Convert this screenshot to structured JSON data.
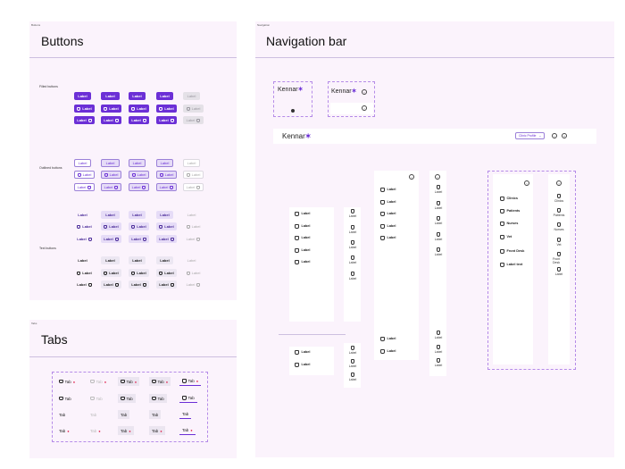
{
  "buttons_frame": {
    "small_label": "Buttons",
    "title": "Buttons",
    "rows": {
      "filled": "Filled buttons",
      "outlined": "Outlined buttons",
      "text": "Text buttons"
    },
    "btn_label": "Label"
  },
  "tabs_frame": {
    "small_label": "Tabs",
    "title": "Tabs",
    "tab_label": "Tab"
  },
  "nav_frame": {
    "small_label": "Navigation",
    "title": "Navigation bar",
    "logo_text": "Kennar",
    "logo_mark": "✶",
    "select_label": "Clinic Profile",
    "item_label": "Label",
    "drawer_items": [
      "Clinics",
      "Patients",
      "Nurses",
      "Vet",
      "Front Desk",
      "Label text"
    ],
    "rail_items": [
      "Clinics",
      "Patients",
      "Nurses",
      "Vet",
      "Front Desk",
      "Label"
    ]
  },
  "colors": {
    "primary": "#6b2fd6",
    "frame_bg": "#fbf3fc",
    "dashed": "#b58be8",
    "badge": "#e0315a"
  }
}
